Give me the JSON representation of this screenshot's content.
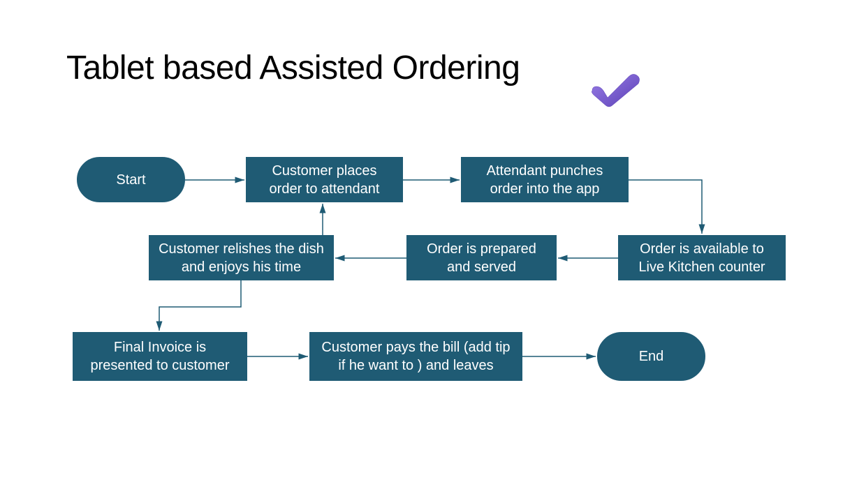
{
  "title": "Tablet based Assisted Ordering",
  "icons": {
    "check": "checkmark-icon"
  },
  "colors": {
    "node_bg": "#1f5b74",
    "node_fg": "#ffffff",
    "arrow": "#1f5b74",
    "check_purple": "#7b5ccf"
  },
  "nodes": {
    "start": {
      "label": "Start",
      "shape": "terminal"
    },
    "n1": {
      "label": "Customer places order to attendant",
      "shape": "rect"
    },
    "n2": {
      "label": "Attendant punches order into the app",
      "shape": "rect"
    },
    "n3": {
      "label": "Order is available to Live Kitchen counter",
      "shape": "rect"
    },
    "n4": {
      "label": "Order is prepared and served",
      "shape": "rect"
    },
    "n5": {
      "label": "Customer relishes the dish and enjoys  his time",
      "shape": "rect"
    },
    "n6": {
      "label": "Final Invoice is presented to customer",
      "shape": "rect"
    },
    "n7": {
      "label": "Customer pays the bill (add tip if he want to ) and  leaves",
      "shape": "rect"
    },
    "end": {
      "label": "End",
      "shape": "terminal"
    }
  },
  "edges": [
    {
      "from": "start",
      "to": "n1"
    },
    {
      "from": "n1",
      "to": "n2"
    },
    {
      "from": "n2",
      "to": "n3"
    },
    {
      "from": "n3",
      "to": "n4"
    },
    {
      "from": "n4",
      "to": "n5"
    },
    {
      "from": "n5",
      "to": "n1",
      "type": "loop-back"
    },
    {
      "from": "n5",
      "to": "n6"
    },
    {
      "from": "n6",
      "to": "n7"
    },
    {
      "from": "n7",
      "to": "end"
    }
  ]
}
